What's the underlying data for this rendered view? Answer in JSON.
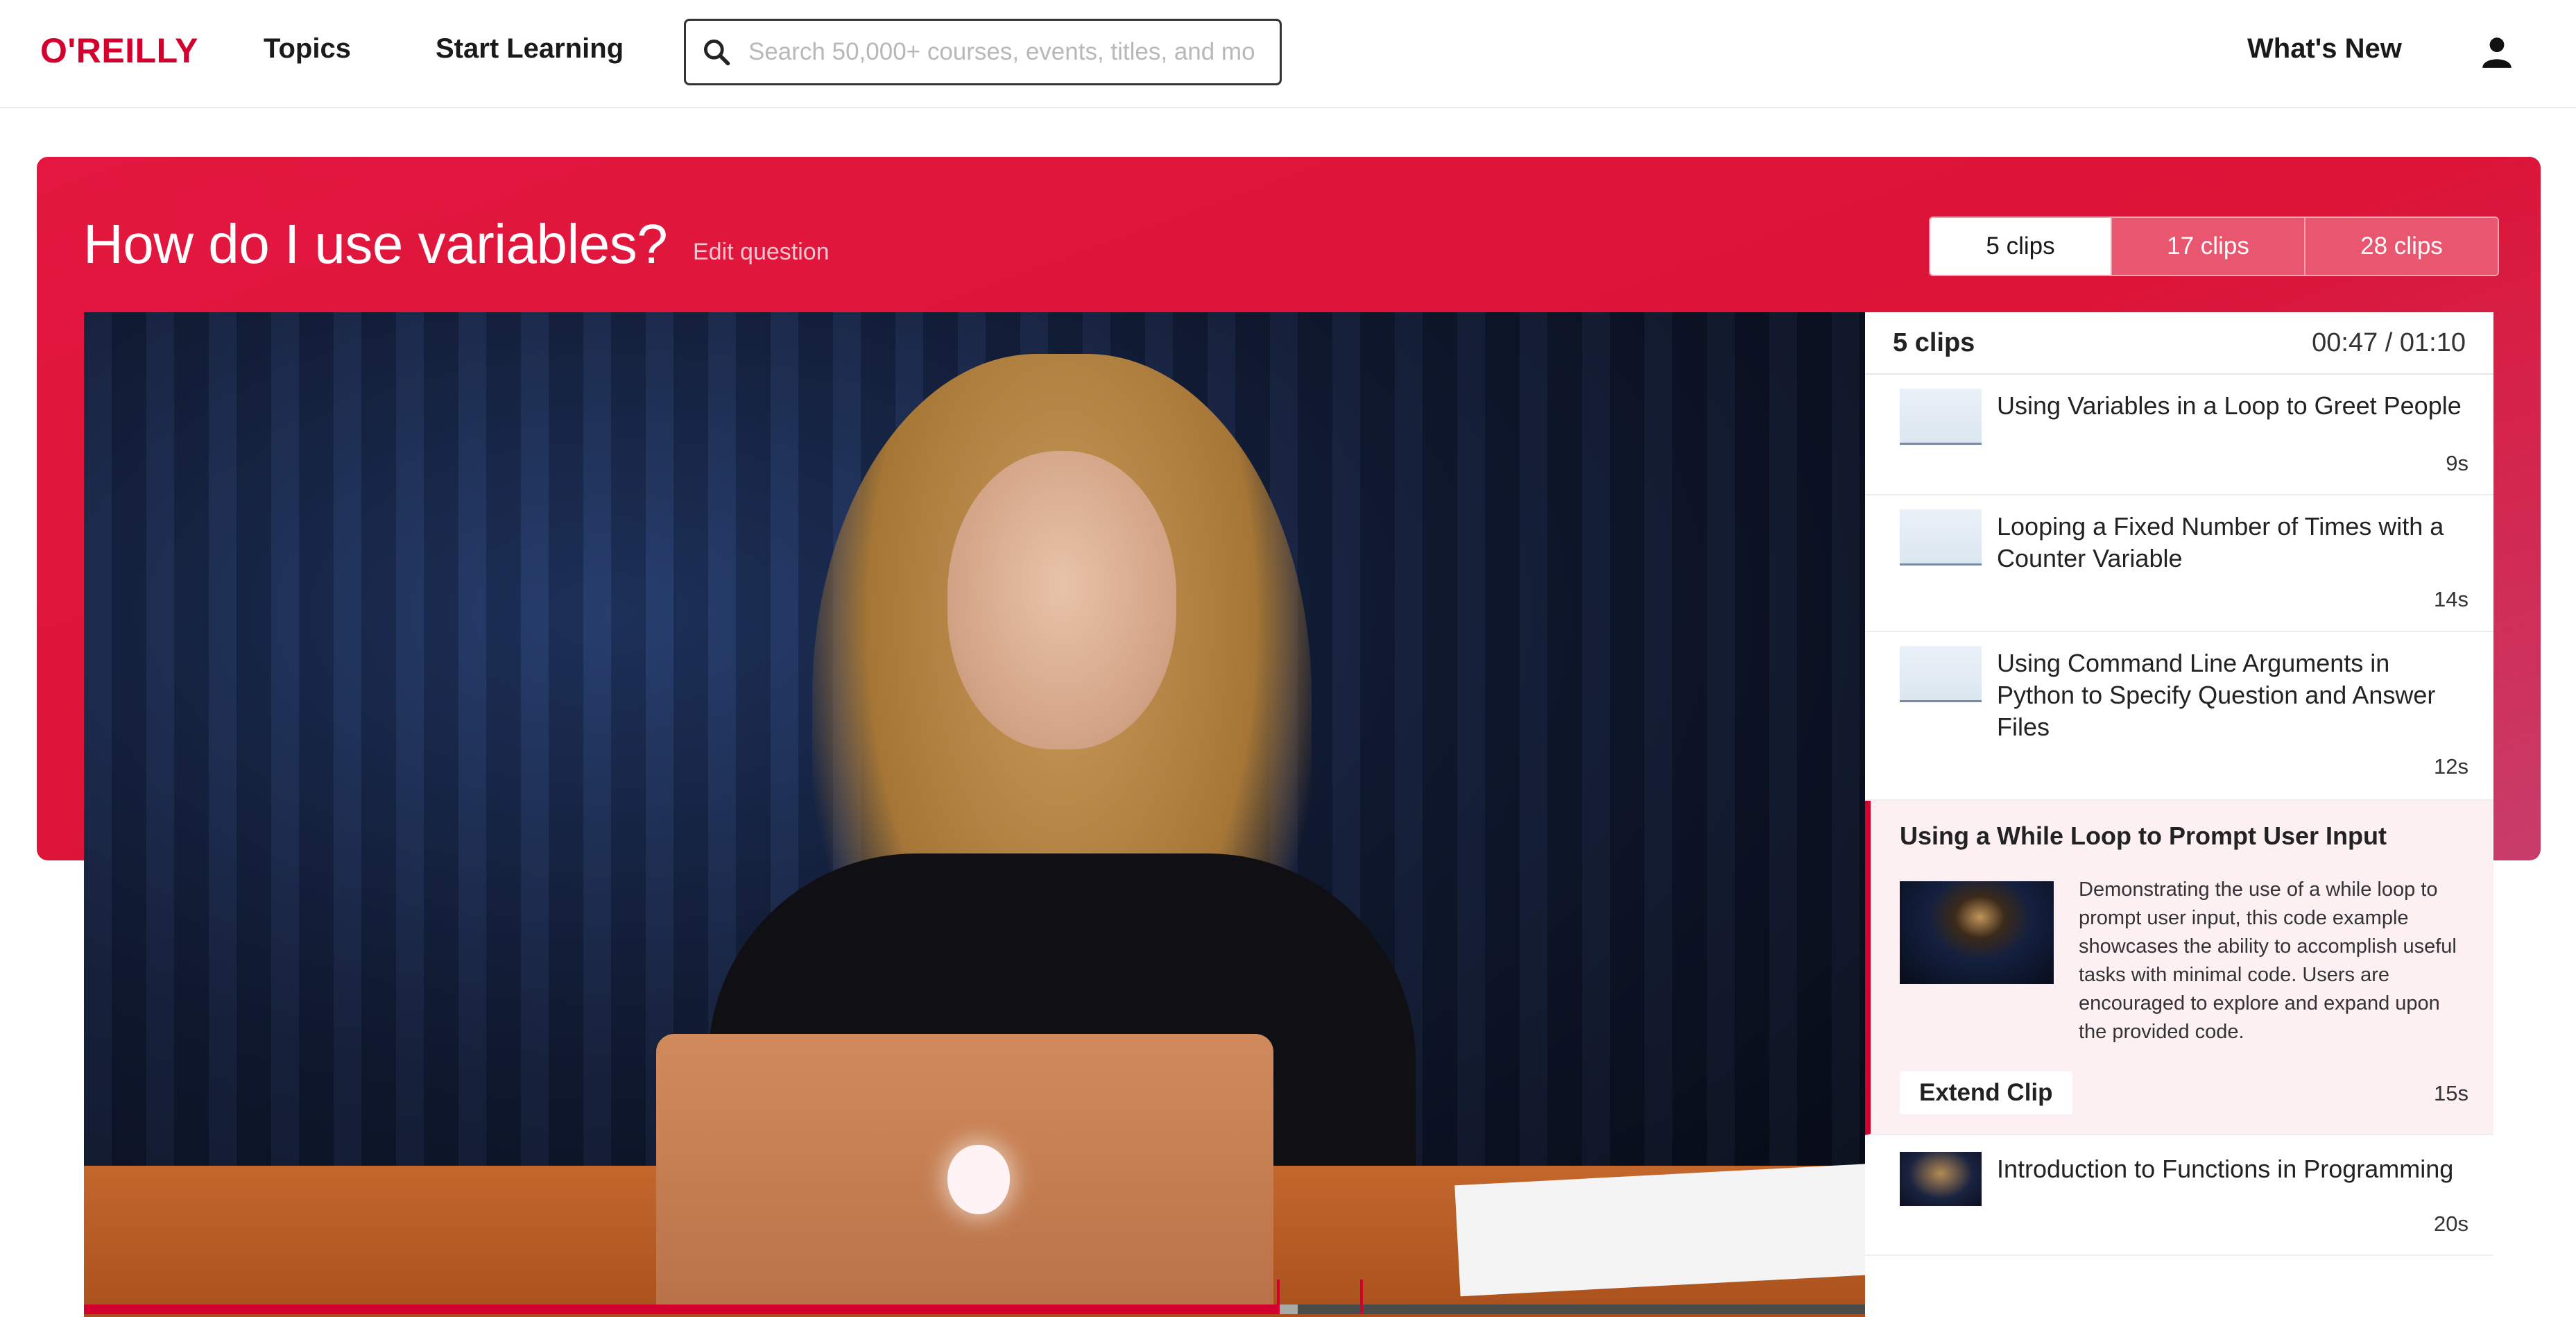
{
  "nav": {
    "logo": "O'REILLY",
    "topics": "Topics",
    "start_learning": "Start Learning",
    "search_placeholder": "Search 50,000+ courses, events, titles, and mo",
    "whats_new": "What's New"
  },
  "hero": {
    "title": "How do I use variables?",
    "edit_question": "Edit question",
    "tabs": [
      {
        "label": "5 clips",
        "active": true
      },
      {
        "label": "17 clips",
        "active": false
      },
      {
        "label": "28 clips",
        "active": false
      }
    ]
  },
  "player": {
    "progress": 0.67
  },
  "panel": {
    "count_label": "5 clips",
    "current_time": "00:47",
    "total_time": "/ 01:10",
    "clips": [
      {
        "title": "Using Variables in a Loop to Greet People",
        "duration": "9s"
      },
      {
        "title": "Looping a Fixed Number of Times with a Counter Variable",
        "duration": "14s"
      },
      {
        "title": "Using Command Line Arguments in Python to Specify Question and Answer Files",
        "duration": "12s"
      },
      {
        "title": "Using a While Loop to Prompt User Input",
        "duration": "15s",
        "description": "Demonstrating the use of a while loop to prompt user input, this code example showcases the ability to accomplish useful tasks with minimal code. Users are encouraged to explore and expand upon the provided code.",
        "extend_label": "Extend Clip"
      },
      {
        "title": "Introduction to Functions in Programming",
        "duration": "20s"
      }
    ]
  },
  "colors": {
    "brand": "#d3002d",
    "hero": "#e3173f"
  }
}
